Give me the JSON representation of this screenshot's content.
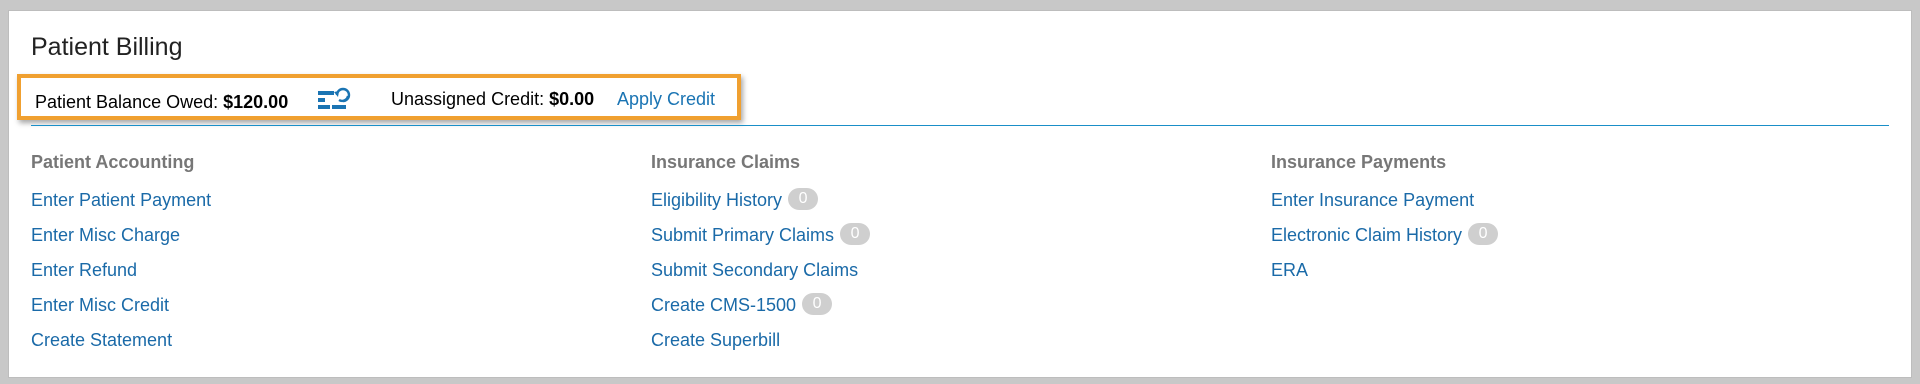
{
  "page": {
    "title": "Patient Billing"
  },
  "balance_bar": {
    "balance_label": "Patient Balance Owed:",
    "balance_value": "$120.00",
    "credit_label": "Unassigned Credit:",
    "credit_value": "$0.00",
    "apply_credit_label": "Apply Credit",
    "refresh_icon": "refresh-balance-icon",
    "highlight_color": "#f0a030"
  },
  "columns": {
    "patient_accounting": {
      "header": "Patient Accounting",
      "links": [
        {
          "label": "Enter Patient Payment"
        },
        {
          "label": "Enter Misc Charge"
        },
        {
          "label": "Enter Refund"
        },
        {
          "label": "Enter Misc Credit"
        },
        {
          "label": "Create Statement"
        }
      ]
    },
    "insurance_claims": {
      "header": "Insurance Claims",
      "links": [
        {
          "label": "Eligibility History",
          "count": "0"
        },
        {
          "label": "Submit Primary Claims",
          "count": "0"
        },
        {
          "label": "Submit Secondary Claims"
        },
        {
          "label": "Create CMS-1500",
          "count": "0"
        },
        {
          "label": "Create Superbill"
        }
      ]
    },
    "insurance_payments": {
      "header": "Insurance Payments",
      "links": [
        {
          "label": "Enter Insurance Payment"
        },
        {
          "label": "Electronic Claim History",
          "count": "0"
        },
        {
          "label": "ERA"
        }
      ]
    }
  },
  "colors": {
    "link": "#1a6aa8",
    "divider": "#1a8fc8",
    "header": "#777777",
    "badge": "#cfcfcf"
  }
}
